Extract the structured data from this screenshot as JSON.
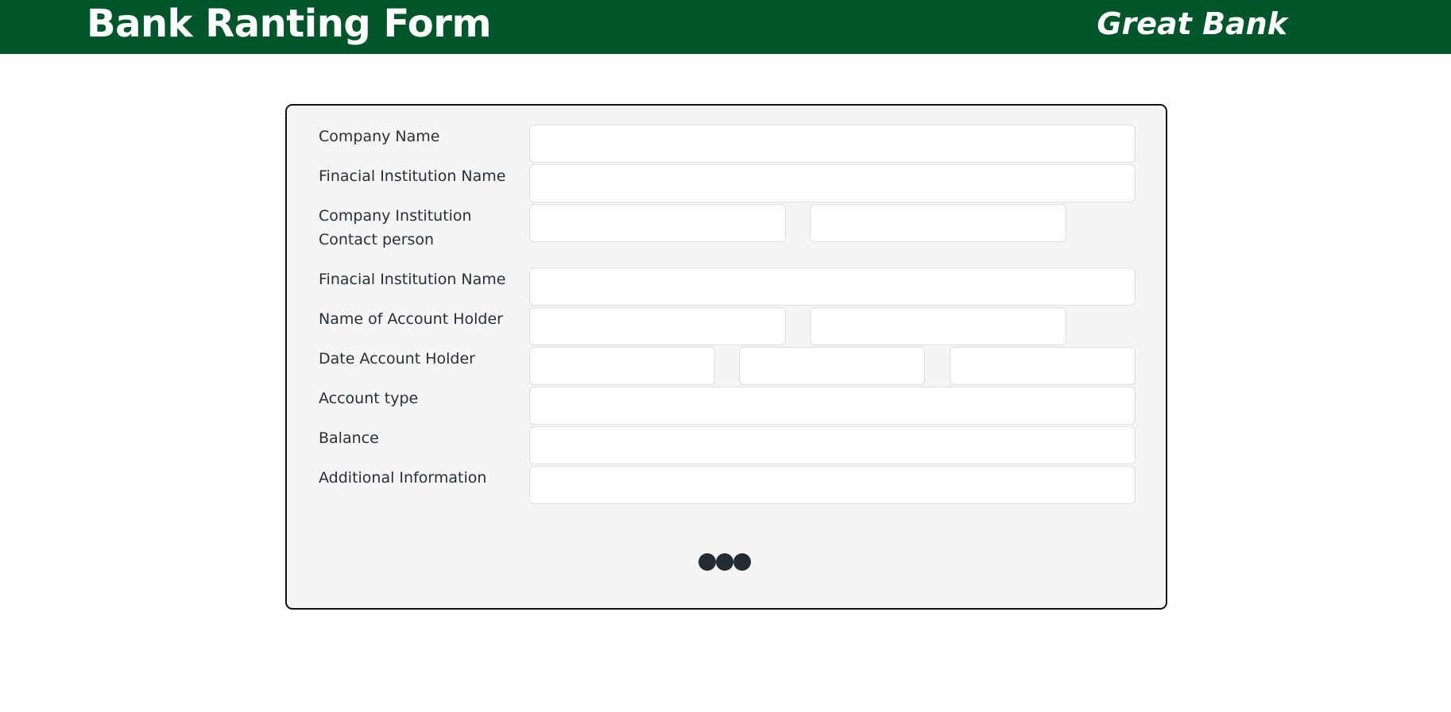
{
  "header": {
    "title": "Bank Ranting Form",
    "brand": "Great Bank",
    "background_color": "#01552a"
  },
  "form": {
    "fields": [
      {
        "label": "Company Name"
      },
      {
        "label": "Finacial Institution Name"
      },
      {
        "label_line1": "Company Institution",
        "label_line2": "Contact person"
      },
      {
        "label": "Finacial Institution Name"
      },
      {
        "label": "Name of Account Holder"
      },
      {
        "label": "Date Account Holder"
      },
      {
        "label": "Account type"
      },
      {
        "label": "Balance"
      },
      {
        "label": "Additional Information"
      }
    ],
    "pagination_icon": "three-dots-icon"
  }
}
